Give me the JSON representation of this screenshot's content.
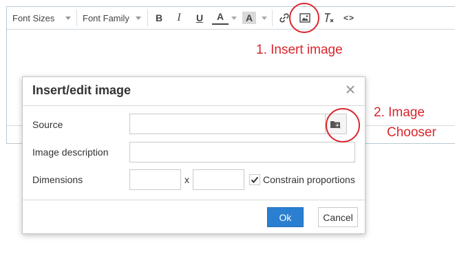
{
  "toolbar": {
    "font_sizes_label": "Font Sizes",
    "font_family_label": "Font Family",
    "bold_label": "B",
    "italic_label": "I",
    "underline_label": "U",
    "text_color_label": "A",
    "bg_color_label": "A",
    "code_label": "<>"
  },
  "annotations": {
    "insert_image": "1. Insert image",
    "image_chooser_line1": "2. Image",
    "image_chooser_line2": "Chooser",
    "color": "#d9252c"
  },
  "dialog": {
    "title": "Insert/edit image",
    "source_label": "Source",
    "source_value": "",
    "description_label": "Image description",
    "description_value": "",
    "dimensions_label": "Dimensions",
    "width_value": "",
    "x_label": "x",
    "height_value": "",
    "constrain_label": "Constrain proportions",
    "constrain_checked": true,
    "ok_label": "Ok",
    "cancel_label": "Cancel",
    "ok_color": "#2b7fd0"
  },
  "icons": {
    "close": "close-icon",
    "link": "link-icon",
    "image": "image-icon",
    "clear_format": "clear-formatting-icon",
    "browse": "folder-search-icon",
    "check": "checkmark-icon"
  }
}
